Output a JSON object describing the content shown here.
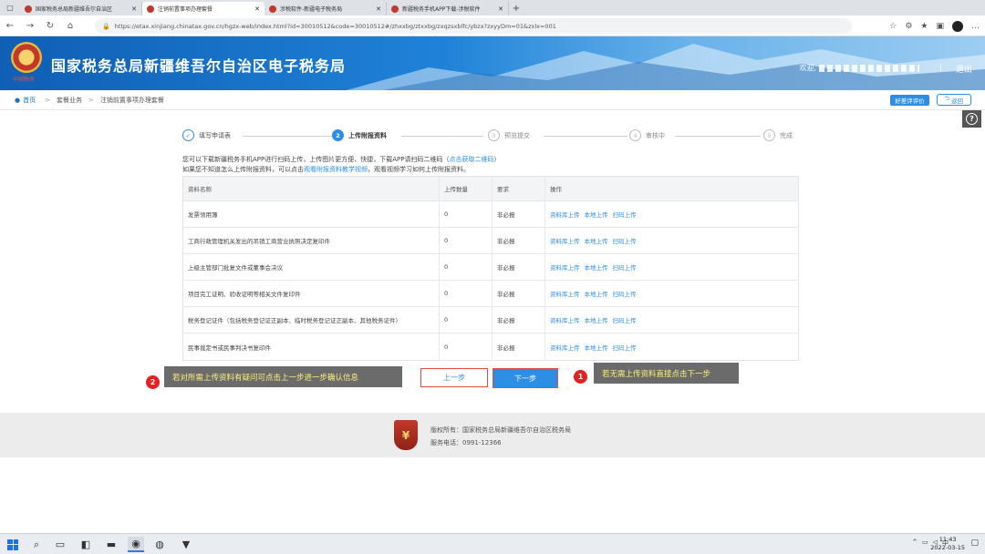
{
  "browser": {
    "tabs": [
      {
        "title": "国家税务总局新疆维吾尔自治区",
        "active": false
      },
      {
        "title": "注销前置事项办理套餐",
        "active": true
      },
      {
        "title": "涉税软件-新疆电子税务局",
        "active": false
      },
      {
        "title": "新疆税务手机APP下载-涉税软件",
        "active": false
      }
    ],
    "url": "https://etax.xinjiang.chinatax.gov.cn/hgzx-web/index.html?id=30010512&code=30010512#/zhxxbg/ztxxbg/zxqzsxblfc/ybzx?zxyyDm=01&zxlx=001"
  },
  "header": {
    "title": "国家税务总局新疆维吾尔自治区电子税务局",
    "slogan": "中国税务",
    "welcome": "欢迎,",
    "separator": "|",
    "logout": "退出"
  },
  "breadcrumb": {
    "home": "首页",
    "items": [
      "套餐业务",
      "注销前置事项办理套餐"
    ],
    "rate_button": "好差评评价",
    "back_button": "返回"
  },
  "help": {
    "label": "?"
  },
  "steps": [
    {
      "num": "✓",
      "label": "填写申请表",
      "state": "done"
    },
    {
      "num": "2",
      "label": "上传附报资料",
      "state": "active"
    },
    {
      "num": "3",
      "label": "预览提交",
      "state": "pending"
    },
    {
      "num": "4",
      "label": "审核中",
      "state": "pending"
    },
    {
      "num": "5",
      "label": "完成",
      "state": "pending"
    }
  ],
  "intro": {
    "line1_a": "您可以下载新疆税务手机APP进行扫码上传，上传图片更方便、快捷，下载APP请扫码二维码（",
    "line1_link": "点击获取二维码",
    "line1_b": "）",
    "line2_a": "如果您不知道怎么上传附报资料，可以点击",
    "line2_link": "观看附报资料教学视频",
    "line2_b": "，观看视频学习如何上传附报资料。"
  },
  "table": {
    "headers": [
      "资料名称",
      "上传数量",
      "要求",
      "操作"
    ],
    "ops": [
      "资料库上传",
      "本地上传",
      "扫码上传"
    ],
    "rows": [
      {
        "name": "发票领用簿",
        "count": "0",
        "req": "非必报"
      },
      {
        "name": "工商行政管理机关发出的吊销工商营业执照决定复印件",
        "count": "0",
        "req": "非必报"
      },
      {
        "name": "上级主管部门批复文件或董事会决议",
        "count": "0",
        "req": "非必报"
      },
      {
        "name": "项目完工证明、验收证明等相关文件复印件",
        "count": "0",
        "req": "非必报"
      },
      {
        "name": "税务登记证件（包括税务登记证正副本、临时税务登记证正副本、其他税务证件）",
        "count": "0",
        "req": "非必报"
      },
      {
        "name": "民事裁定书或民事判决书复印件",
        "count": "0",
        "req": "非必报"
      }
    ]
  },
  "buttons": {
    "prev": "上一步",
    "next": "下一步"
  },
  "callouts": {
    "left": {
      "badge": "2",
      "text": "若对所需上传资料有疑问可点击上一步进一步确认信息"
    },
    "right": {
      "badge": "1",
      "text": "若无需上传资料直接点击下一步"
    }
  },
  "footer": {
    "copyright": "版权所有：国家税务总局新疆维吾尔自治区税务局",
    "phone": "服务电话：0991-12366"
  },
  "taskbar": {
    "time": "11:43",
    "date": "2022-03-15",
    "ime": "中"
  },
  "colors": {
    "primary": "#2d8ee5",
    "highlight": "#e74c3c",
    "callout_text": "#fff07a"
  }
}
